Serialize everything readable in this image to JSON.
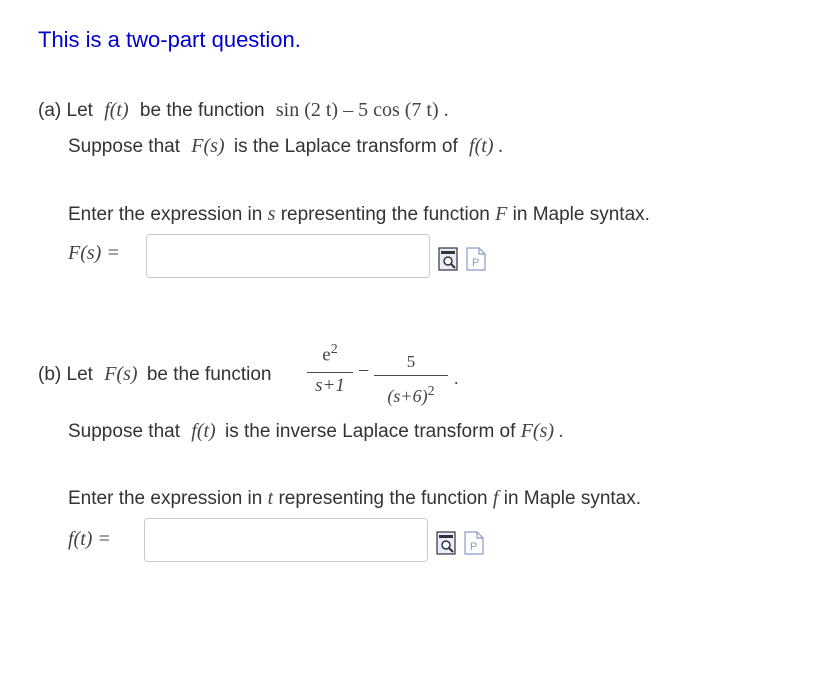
{
  "header": {
    "title": "This is a two-part question."
  },
  "part_a": {
    "let_text": "(a) Let",
    "f_t": "f(t)",
    "be_function": "be the function",
    "expression_sin": "sin (2 t) – 5 cos (7 t) .",
    "suppose_text": "Suppose that",
    "F_s": "F(s)",
    "is_laplace": "is the Laplace transform of",
    "f_t_end": "f(t) .",
    "enter_text": "Enter the expression in",
    "var_s": "s",
    "representing": "representing the function",
    "var_F": "F",
    "maple": "in Maple syntax.",
    "answer_label": "F(s) =",
    "answer_value": ""
  },
  "part_b": {
    "let_text": "(b) Let",
    "F_s": "F(s)",
    "be_function": "be the function",
    "frac1_num": "e",
    "frac1_num_exp": "2",
    "frac1_den": "s+1",
    "minus": "−",
    "frac2_num": "5",
    "frac2_den": "(s+6)",
    "frac2_den_exp": "2",
    "period": ".",
    "suppose_text": "Suppose that",
    "f_t": "f(t)",
    "is_inverse": "is the inverse Laplace transform of",
    "F_s_end": "F(s) .",
    "enter_text": "Enter the expression in",
    "var_t": "t",
    "representing": "representing the function",
    "var_f": "f",
    "maple": "in Maple syntax.",
    "answer_label": "f(t) =",
    "answer_value": ""
  },
  "icons": {
    "preview_icon": "preview-icon",
    "maple_help_icon": "maple-help-icon",
    "accent_color": "#0000cc"
  }
}
